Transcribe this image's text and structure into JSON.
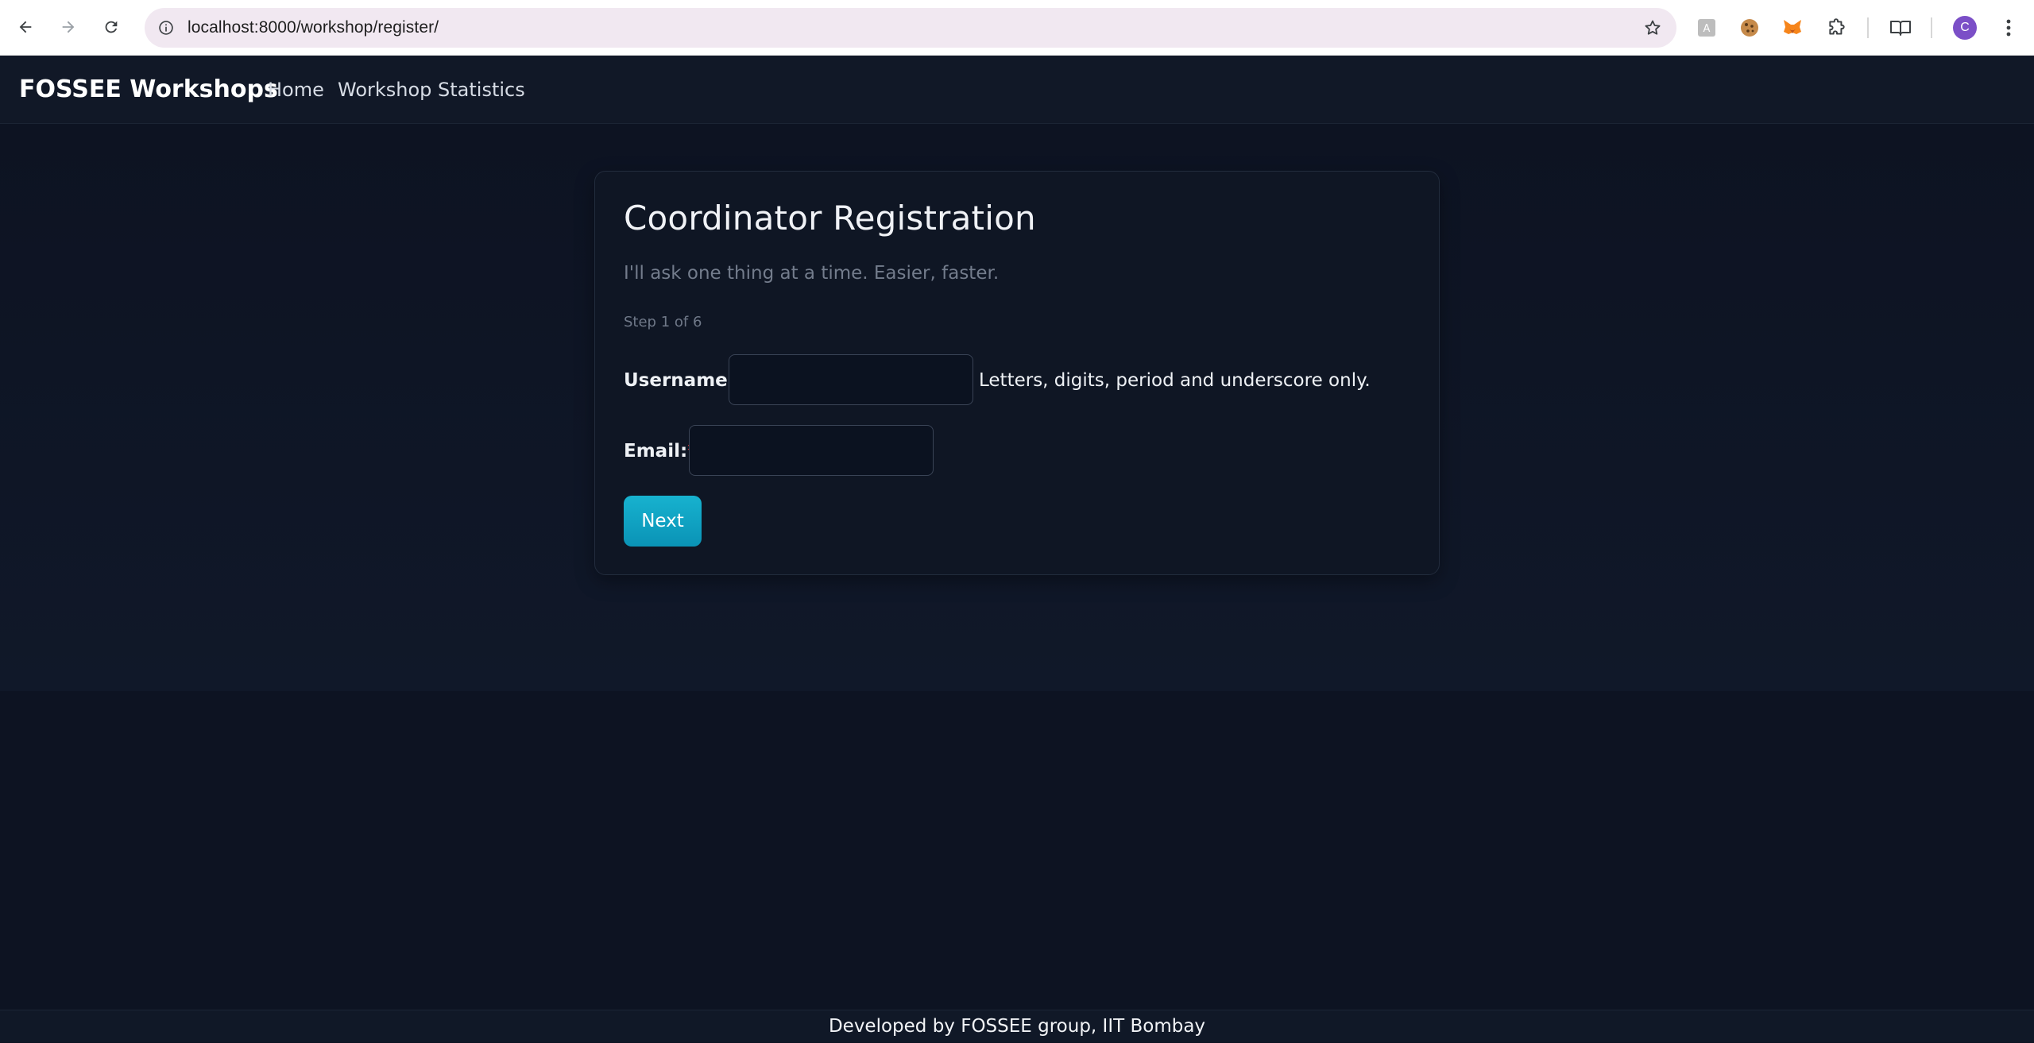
{
  "browser": {
    "url": "localhost:8000/workshop/register/",
    "profile_initial": "C",
    "icons": {
      "back": "back-arrow-icon",
      "forward": "forward-arrow-icon",
      "reload": "reload-icon",
      "info": "site-info-icon",
      "bookmark": "bookmark-star-icon",
      "extensions": [
        "translate-extension-icon",
        "cookie-extension-icon",
        "metamask-fox-extension-icon",
        "puzzle-extensions-icon"
      ],
      "reading_mode": "reading-mode-icon",
      "menu": "kebab-menu-icon"
    }
  },
  "navbar": {
    "brand": "FOSSEE Workshops",
    "links": [
      {
        "label": "Home"
      },
      {
        "label": "Workshop Statistics"
      }
    ]
  },
  "form": {
    "title": "Coordinator Registration",
    "subtitle": "I'll ask one thing at a time. Easier, faster.",
    "step": "Step 1 of 6",
    "fields": [
      {
        "label": "Username:",
        "required_mark": "*",
        "value": "",
        "help": "Letters, digits, period and underscore only."
      },
      {
        "label": "Email:",
        "required_mark": "*",
        "value": ""
      }
    ],
    "next_label": "Next"
  },
  "footer": {
    "text": "Developed by FOSSEE group, IIT Bombay"
  },
  "colors": {
    "page_bg": "#0d1322",
    "card_bg": "#0f1624",
    "accent": "#0ea5c6",
    "required": "#e23b3b"
  }
}
